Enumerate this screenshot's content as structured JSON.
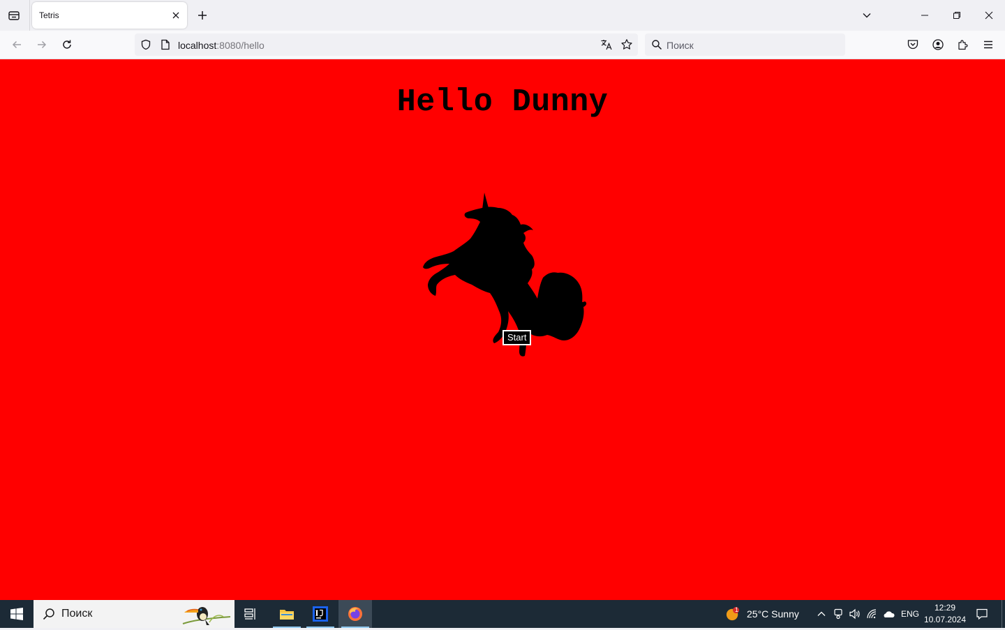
{
  "browser": {
    "tab": {
      "title": "Tetris"
    },
    "url": {
      "host": "localhost",
      "rest": ":8080/hello"
    },
    "search_placeholder": "Поиск"
  },
  "page": {
    "heading": "Hello Dunny",
    "start_label": "Start",
    "background_color": "#ff0000"
  },
  "taskbar": {
    "search_placeholder": "Поиск",
    "weather": {
      "text": "25°C  Sunny",
      "badge": "1"
    },
    "language": "ENG",
    "time": "12:29",
    "date": "10.07.2024"
  }
}
